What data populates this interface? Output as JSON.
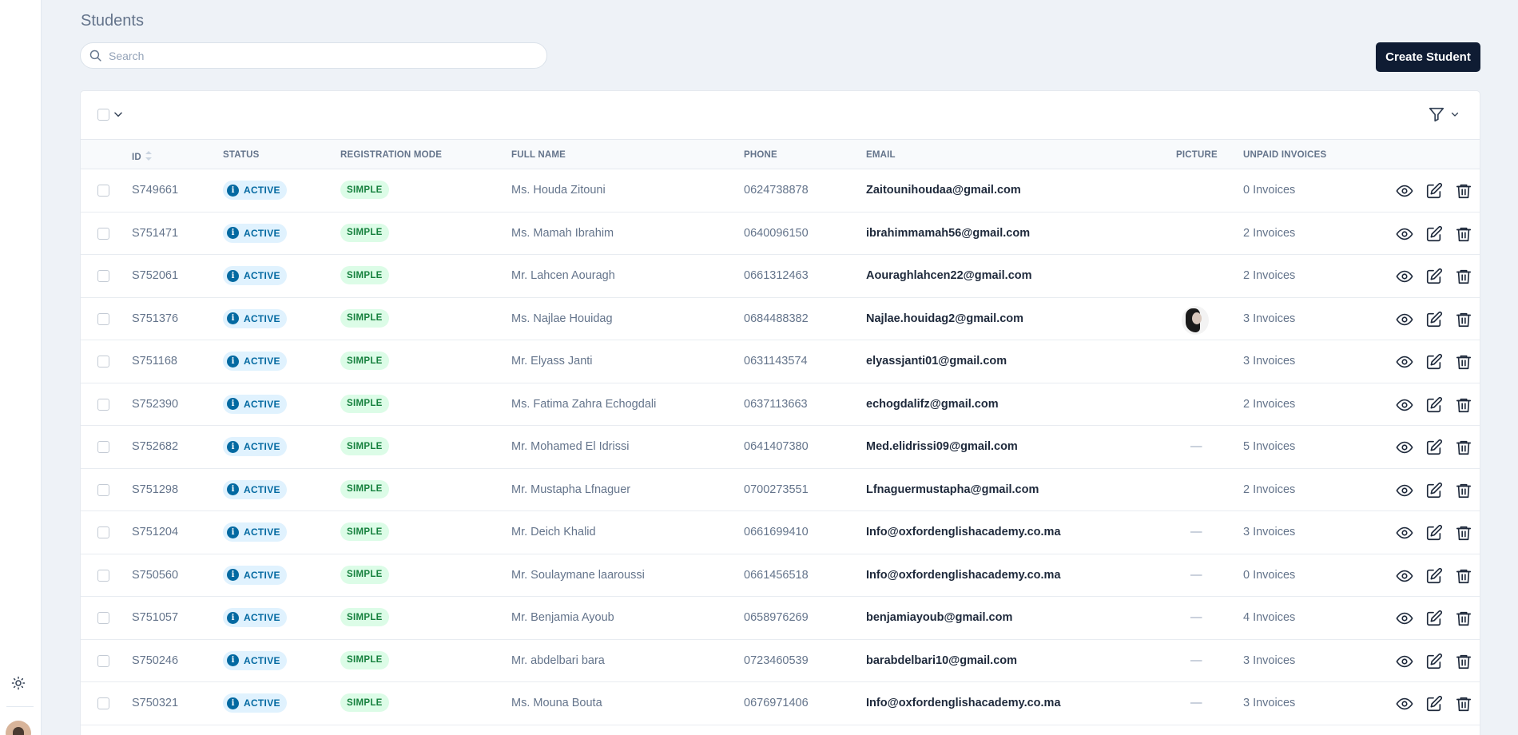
{
  "page": {
    "title": "Students",
    "search_placeholder": "Search",
    "create_button": "Create Student"
  },
  "columns": {
    "id": "ID",
    "status": "STATUS",
    "registration_mode": "REGISTRATION MODE",
    "full_name": "FULL NAME",
    "phone": "PHONE",
    "email": "EMAIL",
    "picture": "PICTURE",
    "unpaid_invoices": "UNPAID INVOICES"
  },
  "rows": [
    {
      "id": "S749661",
      "status": "ACTIVE",
      "mode": "SIMPLE",
      "name": "Ms. Houda Zitouni",
      "phone": "0624738878",
      "email": "Zaitounihoudaa@gmail.com",
      "picture": "",
      "invoices": "0 Invoices"
    },
    {
      "id": "S751471",
      "status": "ACTIVE",
      "mode": "SIMPLE",
      "name": "Ms. Mamah Ibrahim",
      "phone": "0640096150",
      "email": "ibrahimmamah56@gmail.com",
      "picture": "",
      "invoices": "2 Invoices"
    },
    {
      "id": "S752061",
      "status": "ACTIVE",
      "mode": "SIMPLE",
      "name": "Mr. Lahcen Aouragh",
      "phone": "0661312463",
      "email": "Aouraghlahcen22@gmail.com",
      "picture": "",
      "invoices": "2 Invoices"
    },
    {
      "id": "S751376",
      "status": "ACTIVE",
      "mode": "SIMPLE",
      "name": "Ms. Najlae Houidag",
      "phone": "0684488382",
      "email": "Najlae.houidag2@gmail.com",
      "picture": "photo",
      "invoices": "3 Invoices"
    },
    {
      "id": "S751168",
      "status": "ACTIVE",
      "mode": "SIMPLE",
      "name": "Mr. Elyass Janti",
      "phone": "0631143574",
      "email": "elyassjanti01@gmail.com",
      "picture": "",
      "invoices": "3 Invoices"
    },
    {
      "id": "S752390",
      "status": "ACTIVE",
      "mode": "SIMPLE",
      "name": "Ms. Fatima Zahra Echogdali",
      "phone": "0637113663",
      "email": "echogdalifz@gmail.com",
      "picture": "",
      "invoices": "2 Invoices"
    },
    {
      "id": "S752682",
      "status": "ACTIVE",
      "mode": "SIMPLE",
      "name": "Mr. Mohamed El Idrissi",
      "phone": "0641407380",
      "email": "Med.elidrissi09@gmail.com",
      "picture": "—",
      "invoices": "5 Invoices"
    },
    {
      "id": "S751298",
      "status": "ACTIVE",
      "mode": "SIMPLE",
      "name": "Mr. Mustapha Lfnaguer",
      "phone": "0700273551",
      "email": "Lfnaguermustapha@gmail.com",
      "picture": "",
      "invoices": "2 Invoices"
    },
    {
      "id": "S751204",
      "status": "ACTIVE",
      "mode": "SIMPLE",
      "name": "Mr. Deich Khalid",
      "phone": "0661699410",
      "email": "Info@oxfordenglishacademy.co.ma",
      "picture": "—",
      "invoices": "3 Invoices"
    },
    {
      "id": "S750560",
      "status": "ACTIVE",
      "mode": "SIMPLE",
      "name": "Mr. Soulaymane laaroussi",
      "phone": "0661456518",
      "email": "Info@oxfordenglishacademy.co.ma",
      "picture": "—",
      "invoices": "0 Invoices"
    },
    {
      "id": "S751057",
      "status": "ACTIVE",
      "mode": "SIMPLE",
      "name": "Mr. Benjamia Ayoub",
      "phone": "0658976269",
      "email": "benjamiayoub@gmail.com",
      "picture": "—",
      "invoices": "4 Invoices"
    },
    {
      "id": "S750246",
      "status": "ACTIVE",
      "mode": "SIMPLE",
      "name": "Mr. abdelbari bara",
      "phone": "0723460539",
      "email": "barabdelbari10@gmail.com",
      "picture": "—",
      "invoices": "3 Invoices"
    },
    {
      "id": "S750321",
      "status": "ACTIVE",
      "mode": "SIMPLE",
      "name": "Ms. Mouna Bouta",
      "phone": "0676971406",
      "email": "Info@oxfordenglishacademy.co.ma",
      "picture": "—",
      "invoices": "3 Invoices"
    }
  ],
  "icons": {
    "theme": "sun-icon",
    "search": "search-icon",
    "filter": "filter-icon",
    "sort": "sort-icon",
    "view": "eye-icon",
    "edit": "edit-icon",
    "delete": "trash-icon",
    "status": "info-icon"
  },
  "colors": {
    "primary_button": "#0f1c33",
    "status_badge_bg": "#e0f2fe",
    "status_badge_fg": "#0369a1",
    "mode_badge_bg": "#dcfce7",
    "mode_badge_fg": "#15803d",
    "background": "#eef2f7"
  }
}
